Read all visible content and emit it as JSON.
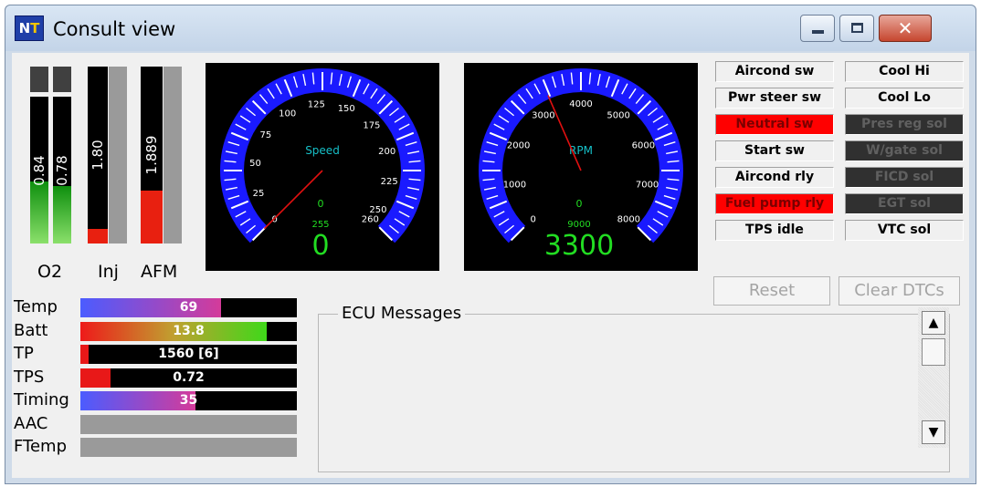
{
  "window": {
    "icon_text_n": "N",
    "icon_text_t": "T",
    "title": "Consult view",
    "minimize_glyph": "",
    "maximize_glyph": "",
    "close_glyph": "✕"
  },
  "vertical_gauges": {
    "o2_a": {
      "value": "0.84",
      "level": 0.42
    },
    "o2_b": {
      "value": "0.78",
      "level": 0.39
    },
    "inj": {
      "value": "1.80",
      "level": 0.08
    },
    "afm": {
      "value": "1.889",
      "level": 0.3
    },
    "captions": {
      "o2": "O2",
      "inj": "Inj",
      "afm": "AFM"
    }
  },
  "speed_gauge": {
    "title": "Speed",
    "scale_labels": [
      "0",
      "25",
      "50",
      "75",
      "100",
      "125",
      "150",
      "175",
      "200",
      "225",
      "250",
      "260"
    ],
    "odometer_small": "0",
    "max_marker": "255",
    "reading": "0",
    "value": 0,
    "max": 260
  },
  "rpm_gauge": {
    "title": "RPM",
    "scale_labels": [
      "0",
      "1000",
      "2000",
      "3000",
      "4000",
      "5000",
      "6000",
      "7000",
      "8000"
    ],
    "odometer_small": "0",
    "max_marker": "9000",
    "reading": "3300",
    "value": 3300,
    "max": 8000
  },
  "status_indicators": {
    "left": [
      {
        "label": "Aircond sw",
        "state": "off"
      },
      {
        "label": "Pwr steer sw",
        "state": "off"
      },
      {
        "label": "Neutral sw",
        "state": "on"
      },
      {
        "label": "Start sw",
        "state": "off"
      },
      {
        "label": "Aircond rly",
        "state": "off"
      },
      {
        "label": "Fuel pump rly",
        "state": "on"
      },
      {
        "label": "TPS idle",
        "state": "off"
      }
    ],
    "right": [
      {
        "label": "Cool Hi",
        "state": "off"
      },
      {
        "label": "Cool Lo",
        "state": "off"
      },
      {
        "label": "Pres reg sol",
        "state": "dim"
      },
      {
        "label": "W/gate sol",
        "state": "dim"
      },
      {
        "label": "FICD sol",
        "state": "dim"
      },
      {
        "label": "EGT sol",
        "state": "dim"
      },
      {
        "label": "VTC sol",
        "state": "off"
      }
    ],
    "colors": {
      "on": "#ff0000",
      "off": "#f0f0f0",
      "dim": "#303030"
    }
  },
  "buttons": {
    "reset": "Reset",
    "clear_dtcs": "Clear DTCs"
  },
  "sensor_bars": [
    {
      "label": "Temp",
      "value": "69",
      "level": 0.65,
      "gradient": "blue-pink"
    },
    {
      "label": "Batt",
      "value": "13.8",
      "level": 0.86,
      "gradient": "red-green"
    },
    {
      "label": "TP",
      "value": "1560 [6]",
      "level": 0.04,
      "gradient": "red"
    },
    {
      "label": "TPS",
      "value": "0.72",
      "level": 0.14,
      "gradient": "red"
    },
    {
      "label": "Timing",
      "value": "35",
      "level": 0.53,
      "gradient": "blue-pink"
    },
    {
      "label": "AAC",
      "value": "",
      "level": 0,
      "gradient": "none"
    },
    {
      "label": "FTemp",
      "value": "",
      "level": 0,
      "gradient": "none"
    }
  ],
  "messages": {
    "legend": "ECU Messages",
    "scroll_up": "▲",
    "scroll_down": "▼"
  },
  "palette": {
    "dial_blue": "#1a1aff",
    "reading_green": "#22dd22",
    "needle_red": "#e01010",
    "title_cyan": "#16c0c8"
  }
}
